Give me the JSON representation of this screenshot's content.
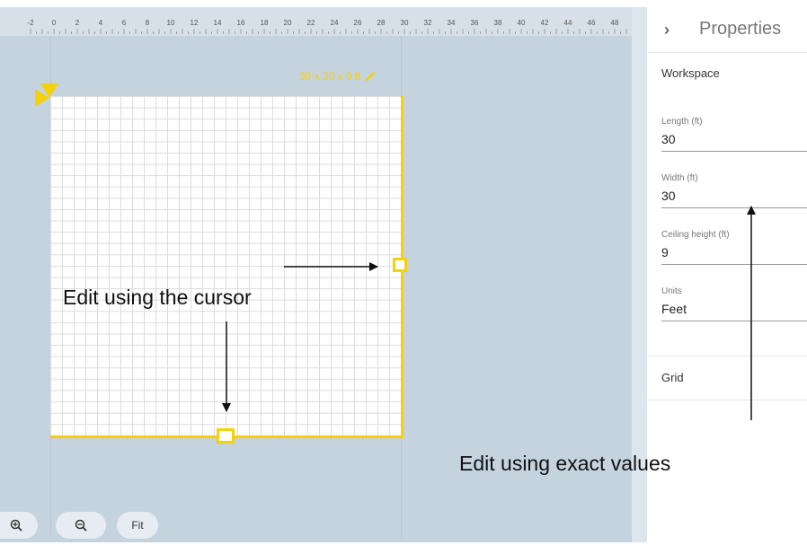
{
  "ruler": {
    "ticks": [
      "-2",
      "0",
      "2",
      "4",
      "6",
      "8",
      "10",
      "12",
      "14",
      "16",
      "18",
      "20",
      "22",
      "24",
      "26",
      "28",
      "30",
      "32",
      "34",
      "36",
      "38",
      "40",
      "42",
      "44",
      "46",
      "48"
    ]
  },
  "room": {
    "dimensions_label": "30 x 30 x 9 ft",
    "accent_color": "#f5d10a"
  },
  "controls": {
    "zoom_in_icon": "zoom-in-icon",
    "zoom_out_icon": "zoom-out-icon",
    "fit_label": "Fit"
  },
  "panel": {
    "collapse_icon": "chevron-right-icon",
    "title": "Properties",
    "workspace_title": "Workspace",
    "fields": [
      {
        "label": "Length (ft)",
        "value": "30"
      },
      {
        "label": "Width (ft)",
        "value": "30"
      },
      {
        "label": "Ceiling height (ft)",
        "value": "9"
      },
      {
        "label": "Units",
        "value": "Feet"
      }
    ],
    "grid_title": "Grid"
  },
  "annotations": {
    "cursor_text": "Edit using the cursor",
    "exact_text": "Edit using exact values"
  }
}
